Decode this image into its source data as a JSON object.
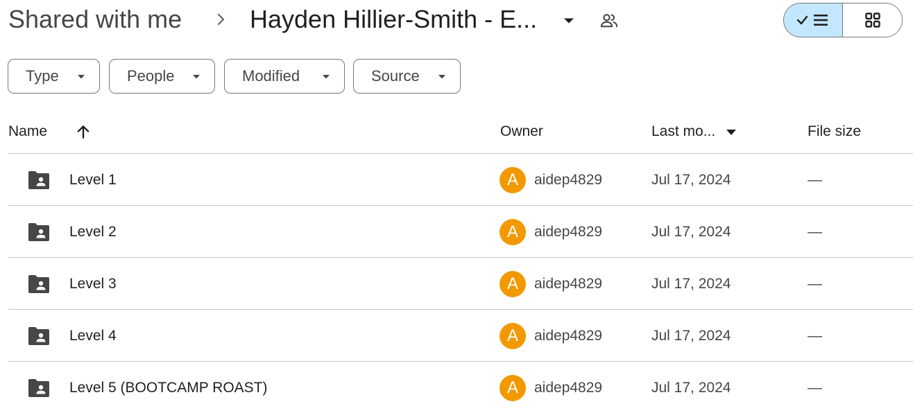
{
  "breadcrumb": {
    "root": "Shared with me",
    "current": "Hayden Hillier-Smith - E..."
  },
  "icons": {
    "separator": "chevron-right-icon",
    "dropdown": "arrow-drop-down-icon",
    "shared": "people-icon",
    "list_view": "checked-list-icon",
    "grid_view": "grid-icon",
    "folder": "shared-folder-icon",
    "sort": "arrow-up-icon"
  },
  "filters": [
    {
      "label": "Type"
    },
    {
      "label": "People"
    },
    {
      "label": "Modified"
    },
    {
      "label": "Source"
    }
  ],
  "table": {
    "columns": {
      "name": "Name",
      "owner": "Owner",
      "last_modified": "Last mo...",
      "file_size": "File size"
    },
    "rows": [
      {
        "name": "Level 1",
        "owner_initial": "A",
        "owner": "aidep4829",
        "modified": "Jul 17, 2024",
        "size": "—"
      },
      {
        "name": "Level 2",
        "owner_initial": "A",
        "owner": "aidep4829",
        "modified": "Jul 17, 2024",
        "size": "—"
      },
      {
        "name": "Level 3",
        "owner_initial": "A",
        "owner": "aidep4829",
        "modified": "Jul 17, 2024",
        "size": "—"
      },
      {
        "name": "Level 4",
        "owner_initial": "A",
        "owner": "aidep4829",
        "modified": "Jul 17, 2024",
        "size": "—"
      },
      {
        "name": "Level 5 (BOOTCAMP ROAST)",
        "owner_initial": "A",
        "owner": "aidep4829",
        "modified": "Jul 17, 2024",
        "size": "—"
      }
    ]
  },
  "colors": {
    "avatar": "#f29900",
    "view_toggle_active": "#c2e7ff"
  }
}
